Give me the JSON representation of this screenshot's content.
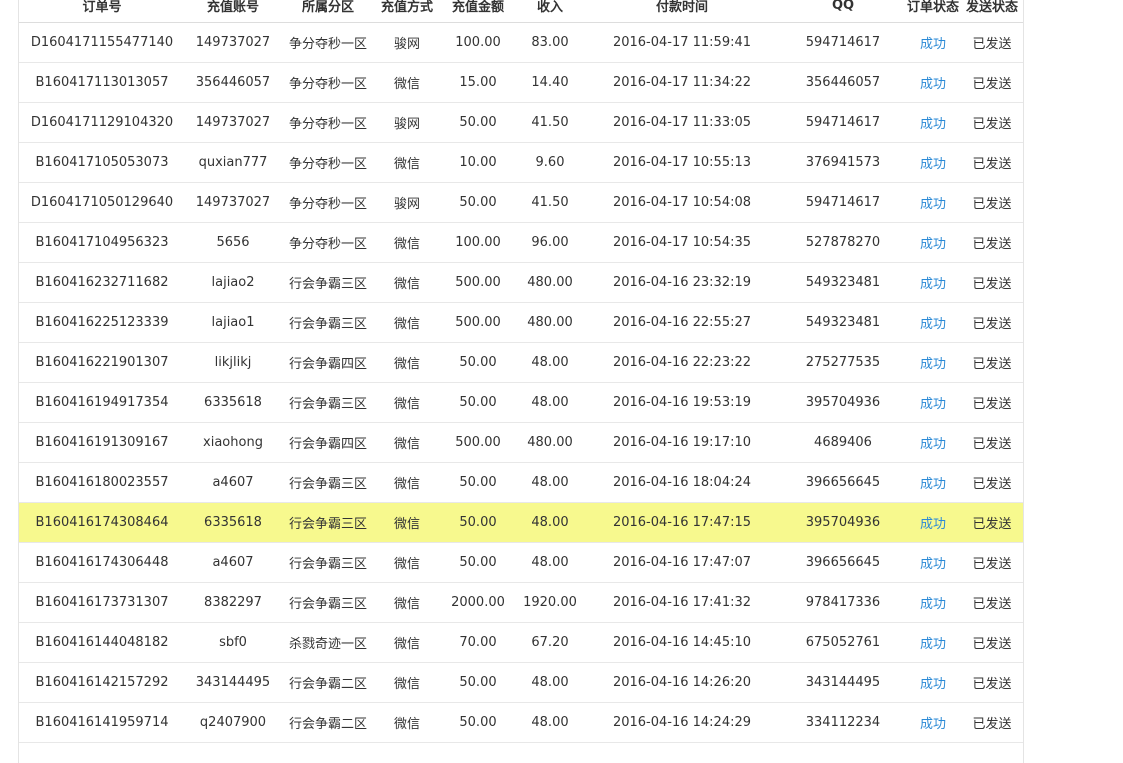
{
  "table": {
    "headers": [
      "订单号",
      "充值账号",
      "所属分区",
      "充值方式",
      "充值金额",
      "收入",
      "付款时间",
      "QQ",
      "订单状态",
      "发送状态"
    ],
    "rows": [
      [
        "D1604171155477140",
        "149737027",
        "争分夺秒一区",
        "骏网",
        "100.00",
        "83.00",
        "2016-04-17 11:59:41",
        "594714617",
        "成功",
        "已发送"
      ],
      [
        "B160417113013057",
        "356446057",
        "争分夺秒一区",
        "微信",
        "15.00",
        "14.40",
        "2016-04-17 11:34:22",
        "356446057",
        "成功",
        "已发送"
      ],
      [
        "D1604171129104320",
        "149737027",
        "争分夺秒一区",
        "骏网",
        "50.00",
        "41.50",
        "2016-04-17 11:33:05",
        "594714617",
        "成功",
        "已发送"
      ],
      [
        "B160417105053073",
        "quxian777",
        "争分夺秒一区",
        "微信",
        "10.00",
        "9.60",
        "2016-04-17 10:55:13",
        "376941573",
        "成功",
        "已发送"
      ],
      [
        "D1604171050129640",
        "149737027",
        "争分夺秒一区",
        "骏网",
        "50.00",
        "41.50",
        "2016-04-17 10:54:08",
        "594714617",
        "成功",
        "已发送"
      ],
      [
        "B160417104956323",
        "5656",
        "争分夺秒一区",
        "微信",
        "100.00",
        "96.00",
        "2016-04-17 10:54:35",
        "527878270",
        "成功",
        "已发送"
      ],
      [
        "B160416232711682",
        "lajiao2",
        "行会争霸三区",
        "微信",
        "500.00",
        "480.00",
        "2016-04-16 23:32:19",
        "549323481",
        "成功",
        "已发送"
      ],
      [
        "B160416225123339",
        "lajiao1",
        "行会争霸三区",
        "微信",
        "500.00",
        "480.00",
        "2016-04-16 22:55:27",
        "549323481",
        "成功",
        "已发送"
      ],
      [
        "B160416221901307",
        "likjlikj",
        "行会争霸四区",
        "微信",
        "50.00",
        "48.00",
        "2016-04-16 22:23:22",
        "275277535",
        "成功",
        "已发送"
      ],
      [
        "B160416194917354",
        "6335618",
        "行会争霸三区",
        "微信",
        "50.00",
        "48.00",
        "2016-04-16 19:53:19",
        "395704936",
        "成功",
        "已发送"
      ],
      [
        "B160416191309167",
        "xiaohong",
        "行会争霸四区",
        "微信",
        "500.00",
        "480.00",
        "2016-04-16 19:17:10",
        "4689406",
        "成功",
        "已发送"
      ],
      [
        "B160416180023557",
        "a4607",
        "行会争霸三区",
        "微信",
        "50.00",
        "48.00",
        "2016-04-16 18:04:24",
        "396656645",
        "成功",
        "已发送"
      ],
      [
        "B160416174308464",
        "6335618",
        "行会争霸三区",
        "微信",
        "50.00",
        "48.00",
        "2016-04-16 17:47:15",
        "395704936",
        "成功",
        "已发送"
      ],
      [
        "B160416174306448",
        "a4607",
        "行会争霸三区",
        "微信",
        "50.00",
        "48.00",
        "2016-04-16 17:47:07",
        "396656645",
        "成功",
        "已发送"
      ],
      [
        "B160416173731307",
        "8382297",
        "行会争霸三区",
        "微信",
        "2000.00",
        "1920.00",
        "2016-04-16 17:41:32",
        "978417336",
        "成功",
        "已发送"
      ],
      [
        "B160416144048182",
        "sbf0",
        "杀戮奇迹一区",
        "微信",
        "70.00",
        "67.20",
        "2016-04-16 14:45:10",
        "675052761",
        "成功",
        "已发送"
      ],
      [
        "B160416142157292",
        "343144495",
        "行会争霸二区",
        "微信",
        "50.00",
        "48.00",
        "2016-04-16 14:26:20",
        "343144495",
        "成功",
        "已发送"
      ],
      [
        "B160416141959714",
        "q2407900",
        "行会争霸二区",
        "微信",
        "50.00",
        "48.00",
        "2016-04-16 14:24:29",
        "334112234",
        "成功",
        "已发送"
      ]
    ],
    "highlighted_order": "B160416174308464",
    "status_color": "#2b8ad6",
    "highlight_color": "#f7f98e"
  }
}
